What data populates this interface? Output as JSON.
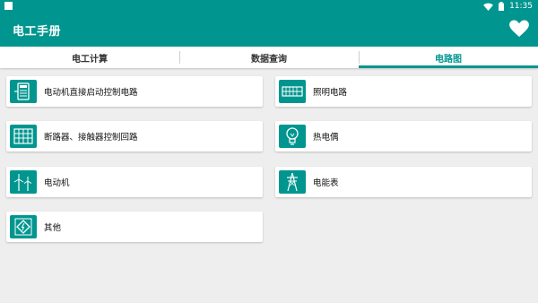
{
  "status_bar": {
    "time": "11:35"
  },
  "app_bar": {
    "title": "电工手册",
    "favorite_icon": "heart-icon"
  },
  "tabs": [
    {
      "label": "电工计算",
      "active": false
    },
    {
      "label": "数据查询",
      "active": false
    },
    {
      "label": "电路图",
      "active": true
    }
  ],
  "items": [
    {
      "label": "电动机直接启动控制电路",
      "icon": "motor-starter-icon"
    },
    {
      "label": "照明电路",
      "icon": "lighting-circuit-icon"
    },
    {
      "label": "断路器、接触器控制回路",
      "icon": "breaker-panel-icon"
    },
    {
      "label": "热电偶",
      "icon": "lightbulb-icon"
    },
    {
      "label": "电动机",
      "icon": "wind-turbine-icon"
    },
    {
      "label": "电能表",
      "icon": "transmission-tower-icon"
    },
    {
      "label": "其他",
      "icon": "warning-sign-icon"
    }
  ],
  "colors": {
    "primary": "#00968f",
    "background": "#eeeeee",
    "card": "#ffffff"
  }
}
